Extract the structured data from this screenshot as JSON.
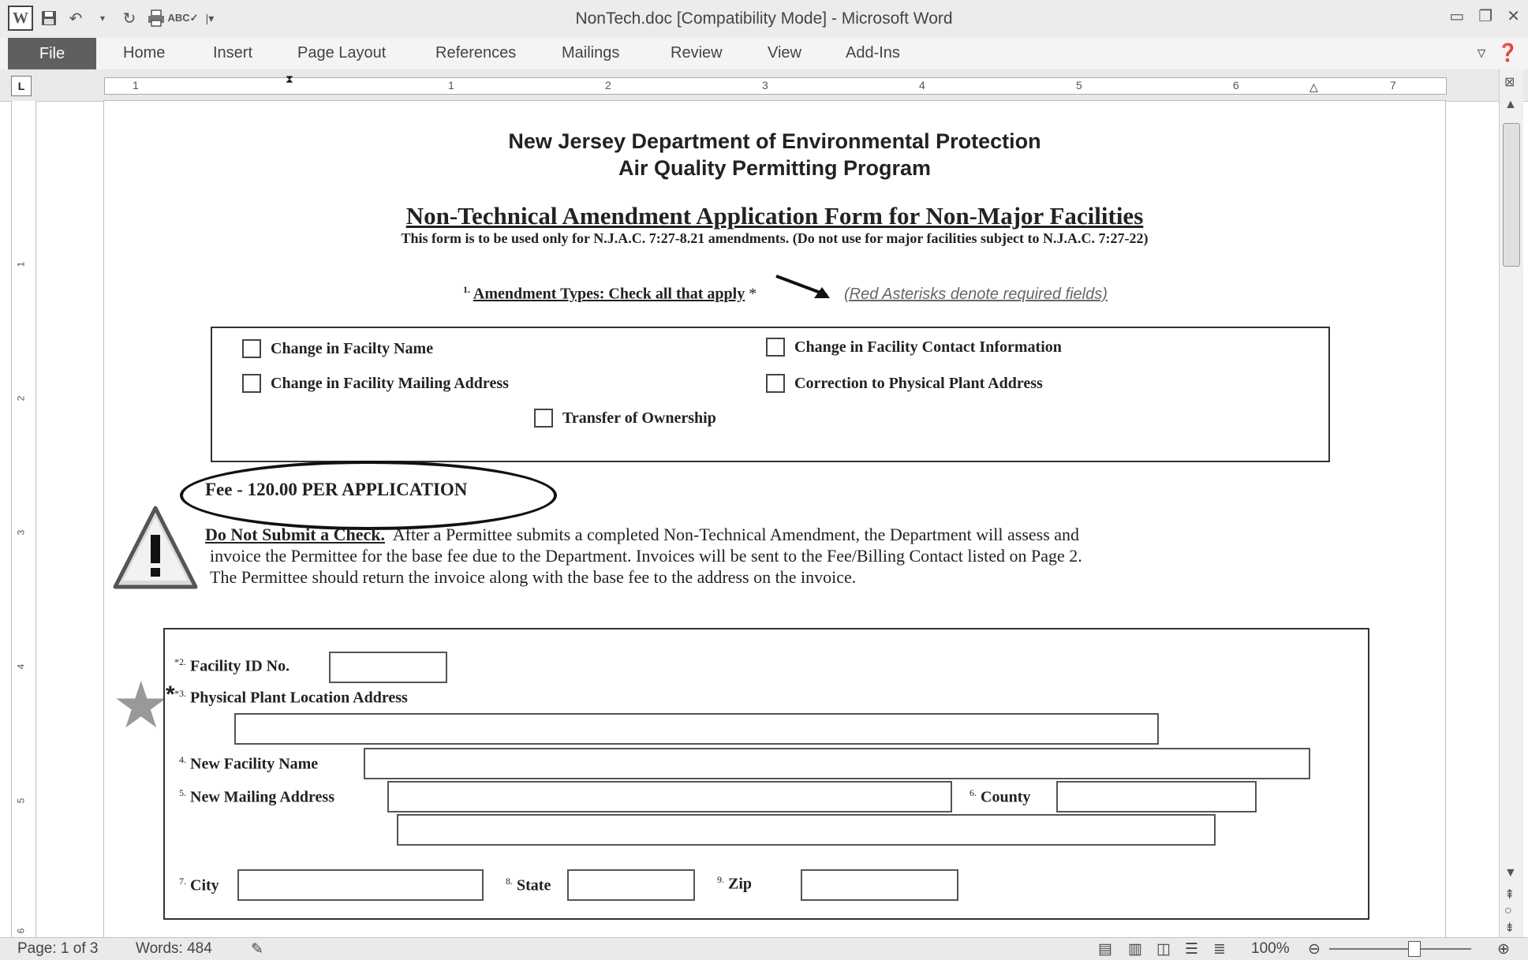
{
  "window": {
    "title": "NonTech.doc [Compatibility Mode]  -  Microsoft Word"
  },
  "ribbon": {
    "file": "File",
    "tabs": [
      "Home",
      "Insert",
      "Page Layout",
      "References",
      "Mailings",
      "Review",
      "View",
      "Add-Ins"
    ]
  },
  "ruler": {
    "numbers": [
      "1",
      "1",
      "2",
      "3",
      "4",
      "5",
      "6",
      "7"
    ],
    "corner": "L"
  },
  "vruler": {
    "numbers": [
      "1",
      "2",
      "3",
      "4",
      "5",
      "6"
    ]
  },
  "document": {
    "header_line1": "New Jersey Department of Environmental Protection",
    "header_line2": "Air Quality Permitting Program",
    "form_title": "Non-Technical Amendment Application Form for Non-Major Facilities",
    "form_subtitle": "This form is to be used only for N.J.A.C. 7:27-8.21 amendments. (Do not use for major facilities subject to N.J.A.C. 7:27-22)",
    "amendment_number": "1.",
    "amendment_label": "Amendment Types:  Check all that apply",
    "amendment_asterisk": "*",
    "required_note": "(Red Asterisks denote required fields)",
    "checkboxes": [
      "Change in Facilty Name",
      "Change in Facility Contact Information",
      "Change in Facility Mailing Address",
      "Correction to Physical Plant Address",
      "Transfer of Ownership"
    ],
    "fee": "Fee - 120.00 PER APPLICATION",
    "warning_bold": "Do Not Submit a Check.",
    "warning_line1": "After a Permittee submits a completed Non-Technical Amendment, the Department will assess and",
    "warning_line2": "invoice the Permittee for the base fee due to the Department.  Invoices will be sent to the Fee/Billing Contact listed on Page 2.",
    "warning_line3": "The Permittee should return the invoice along with the base fee to the address on the invoice.",
    "fields": {
      "facility_id": {
        "num": "*2.",
        "label": "Facility ID No."
      },
      "physical_address": {
        "num": "*3.",
        "label": "Physical Plant Location Address"
      },
      "new_name": {
        "num": "4.",
        "label": "New Facility Name"
      },
      "new_mailing": {
        "num": "5.",
        "label": "New Mailing Address"
      },
      "county": {
        "num": "6.",
        "label": "County"
      },
      "city": {
        "num": "7.",
        "label": "City"
      },
      "state": {
        "num": "8.",
        "label": "State"
      },
      "zip": {
        "num": "9.",
        "label": "Zip"
      }
    }
  },
  "status": {
    "page": "Page: 1 of 3",
    "words": "Words: 484",
    "zoom": "100%",
    "zoom_level_percent": 100
  }
}
